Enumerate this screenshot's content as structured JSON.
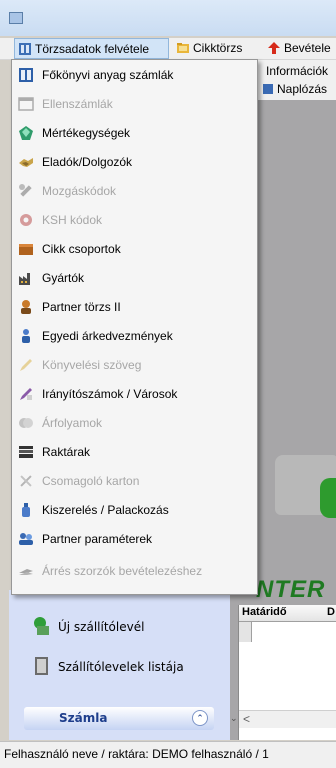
{
  "menubar": {
    "items": [
      {
        "label": "Törzsadatok felvétele",
        "icon": "book-icon"
      },
      {
        "label": "Cikktörzs",
        "icon": "folder-icon"
      },
      {
        "label": "Bevétele",
        "icon": "red-arrow-icon"
      }
    ]
  },
  "submenu": {
    "items": [
      {
        "label": "Információk"
      },
      {
        "label": "Naplózás"
      }
    ]
  },
  "dropdown": {
    "items": [
      {
        "label": "Főkönyvi anyag számlák",
        "icon": "ledger-icon",
        "enabled": true
      },
      {
        "label": "Ellenszámlák",
        "icon": "window-icon",
        "enabled": false
      },
      {
        "label": "Mértékegységek",
        "icon": "gem-icon",
        "enabled": true
      },
      {
        "label": "Eladók/Dolgozók",
        "icon": "handshake-icon",
        "enabled": true
      },
      {
        "label": "Mozgáskódok",
        "icon": "wrench-icon",
        "enabled": false
      },
      {
        "label": "KSH kódok",
        "icon": "gear-icon",
        "enabled": false
      },
      {
        "label": "Cikk csoportok",
        "icon": "box-icon",
        "enabled": true
      },
      {
        "label": "Gyártók",
        "icon": "factory-icon",
        "enabled": true
      },
      {
        "label": "Partner törzs II",
        "icon": "person-icon",
        "enabled": true
      },
      {
        "label": "Egyedi árkedvezmények",
        "icon": "people-icon",
        "enabled": true
      },
      {
        "label": "Könyvelési szöveg",
        "icon": "pen-icon",
        "enabled": false
      },
      {
        "label": "Irányítószámok / Városok",
        "icon": "signpost-icon",
        "enabled": true
      },
      {
        "label": "Árfolyamok",
        "icon": "coins-icon",
        "enabled": false
      },
      {
        "label": "Raktárak",
        "icon": "warehouse-icon",
        "enabled": true
      },
      {
        "label": "Csomagoló karton",
        "icon": "tools-icon",
        "enabled": false
      },
      {
        "label": "Kiszerelés / Palackozás",
        "icon": "bottle-icon",
        "enabled": true
      },
      {
        "label": "Partner paraméterek",
        "icon": "partners-icon",
        "enabled": true
      },
      {
        "label": "Árrés szorzók bevételezéshez",
        "icon": "pliers-icon",
        "enabled": false
      }
    ]
  },
  "leftpanel": {
    "items": [
      {
        "label": "Új szállítólevél",
        "icon": "new-document-icon"
      },
      {
        "label": "Szállítólevelek listája",
        "icon": "document-list-icon"
      }
    ],
    "section": {
      "title": "Számla",
      "button_icon": "collapse-up-icon"
    }
  },
  "workarea": {
    "brand_text": "NTER",
    "grid": {
      "headers": [
        "Határidő",
        "D"
      ]
    }
  },
  "statusbar": {
    "text": "Felhasználó neve / raktára: DEMO felhasználó / 1"
  },
  "colors": {
    "menu_highlight": "#d2e4f7",
    "disabled_text": "#a6a6a6",
    "panel_bg": "#d6dff7",
    "section_title": "#1e3e8c",
    "brand_green": "#1f7a22"
  }
}
